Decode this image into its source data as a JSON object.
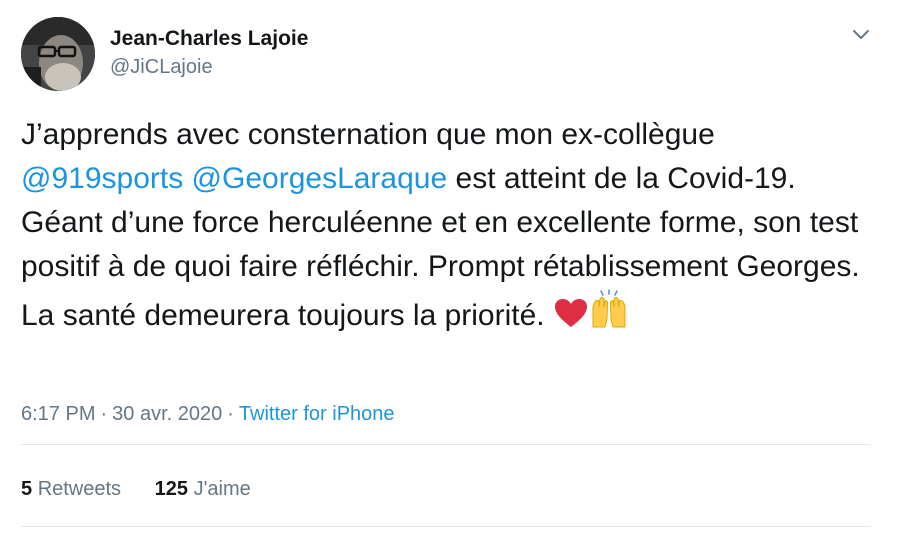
{
  "author": {
    "display_name": "Jean-Charles Lajoie",
    "handle": "@JiCLajoie",
    "avatar_icon": "profile-photo"
  },
  "tweet": {
    "text_part1": "J’apprends avec consternation que mon ex-collègue ",
    "mention1": "@919sports",
    "mention2": "@GeorgesLaraque",
    "text_part2": " est atteint de la Covid-19. Géant d’une force herculéenne et en excellente forme, son test positif à de quoi faire réfléchir. Prompt rétablissement Georges. La santé demeurera toujours la priorité. ",
    "emojis": [
      "red-heart-icon",
      "raising-hands-icon"
    ]
  },
  "meta": {
    "time": "6:17 PM",
    "separator1": "·",
    "date": "30 avr. 2020",
    "separator2": "·",
    "source": "Twitter for iPhone"
  },
  "stats": {
    "retweets_count": "5",
    "retweets_label": "Retweets",
    "likes_count": "125",
    "likes_label": "J'aime"
  },
  "colors": {
    "link": "#1b95e0",
    "secondary_text": "#657786",
    "primary_text": "#14171a",
    "divider": "#e1e8ed"
  },
  "icons": {
    "caret": "chevron-down-icon"
  }
}
